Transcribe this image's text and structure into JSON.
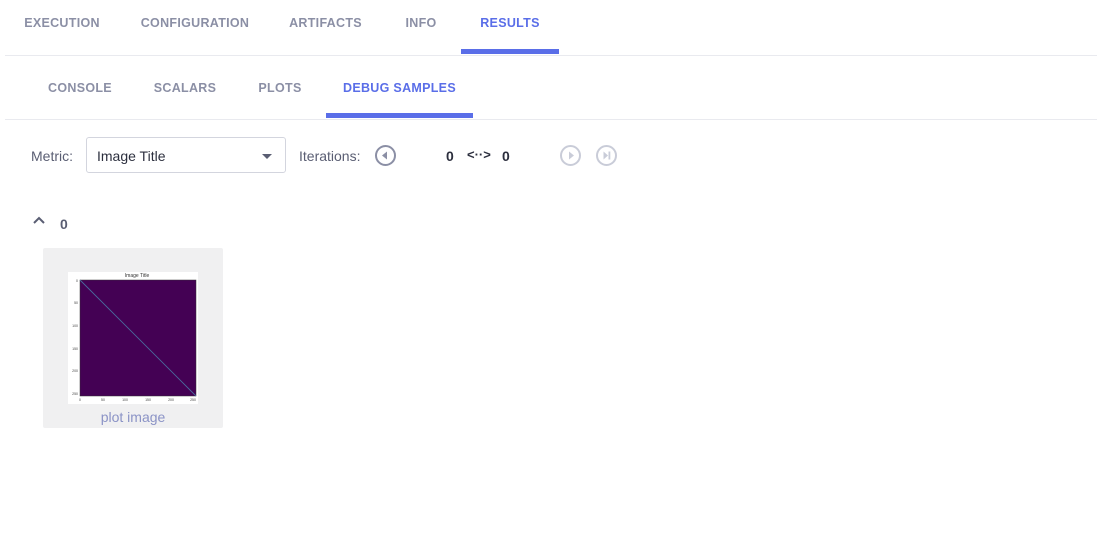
{
  "tabs_top": [
    {
      "label": "EXECUTION",
      "active": false
    },
    {
      "label": "CONFIGURATION",
      "active": false
    },
    {
      "label": "ARTIFACTS",
      "active": false
    },
    {
      "label": "INFO",
      "active": false
    },
    {
      "label": "RESULTS",
      "active": true
    }
  ],
  "tabs_sub": [
    {
      "label": "CONSOLE",
      "active": false
    },
    {
      "label": "SCALARS",
      "active": false
    },
    {
      "label": "PLOTS",
      "active": false
    },
    {
      "label": "DEBUG SAMPLES",
      "active": true
    }
  ],
  "controls": {
    "metric_label": "Metric:",
    "metric_value": "Image Title",
    "iterations_label": "Iterations:",
    "iter_from": "0",
    "iter_sep": "<··>",
    "iter_to": "0"
  },
  "group": {
    "count": "0"
  },
  "sample": {
    "caption": "plot image",
    "thumb_title": "Image Title",
    "y_ticks": [
      "0",
      "50",
      "100",
      "150",
      "200",
      "250"
    ],
    "x_ticks": [
      "0",
      "50",
      "100",
      "150",
      "200",
      "250"
    ]
  },
  "colors": {
    "accent": "#5a6ee8",
    "plot_fill": "#440154",
    "card_bg": "#f0f0f1"
  },
  "icons": {
    "prev": "circle-chevron-left-icon",
    "next": "circle-chevron-right-icon",
    "last": "circle-skip-end-icon",
    "collapse": "chevron-up-icon",
    "dropdown": "caret-down-icon"
  }
}
